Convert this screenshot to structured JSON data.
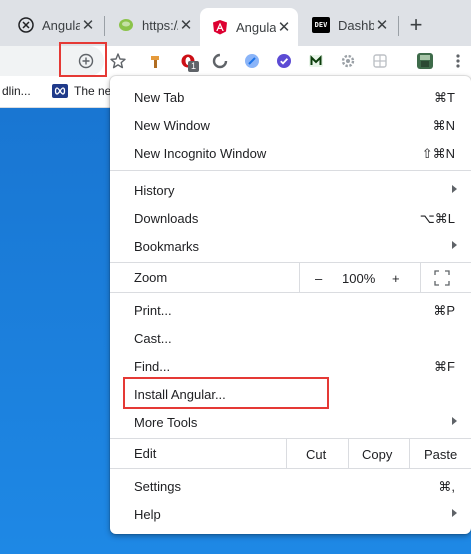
{
  "tabs": [
    {
      "title": "Angular",
      "favicon": "angular-outline-icon",
      "active": false
    },
    {
      "title": "https://",
      "favicon": "leaf-icon",
      "active": false
    },
    {
      "title": "Angular",
      "favicon": "angular-logo-icon",
      "active": true
    },
    {
      "title": "Dashboard",
      "favicon": "dev-logo-icon",
      "active": false
    }
  ],
  "new_tab_glyph": "+",
  "close_glyph": "✕",
  "dev_logo_text": "DEV",
  "extension_badge": "1",
  "bookmarks": [
    {
      "label": "dlin..."
    },
    {
      "label": "The ne"
    }
  ],
  "menu": {
    "new_tab": {
      "label": "New Tab",
      "shortcut": "⌘T"
    },
    "new_window": {
      "label": "New Window",
      "shortcut": "⌘N"
    },
    "new_incognito": {
      "label": "New Incognito Window",
      "shortcut": "⇧⌘N"
    },
    "history": {
      "label": "History"
    },
    "downloads": {
      "label": "Downloads",
      "shortcut": "⌥⌘L"
    },
    "bookmarks": {
      "label": "Bookmarks"
    },
    "zoom": {
      "label": "Zoom",
      "minus": "–",
      "level": "100%",
      "plus": "+"
    },
    "print": {
      "label": "Print...",
      "shortcut": "⌘P"
    },
    "cast": {
      "label": "Cast..."
    },
    "find": {
      "label": "Find...",
      "shortcut": "⌘F"
    },
    "install": {
      "label": "Install Angular..."
    },
    "more_tools": {
      "label": "More Tools"
    },
    "edit": {
      "label": "Edit",
      "cut": "Cut",
      "copy": "Copy",
      "paste": "Paste"
    },
    "settings": {
      "label": "Settings",
      "shortcut": "⌘,"
    },
    "help": {
      "label": "Help"
    }
  },
  "colors": {
    "highlight_box": "#e53935",
    "angular_red": "#dd0031",
    "page_blue": "#1e88e5"
  }
}
